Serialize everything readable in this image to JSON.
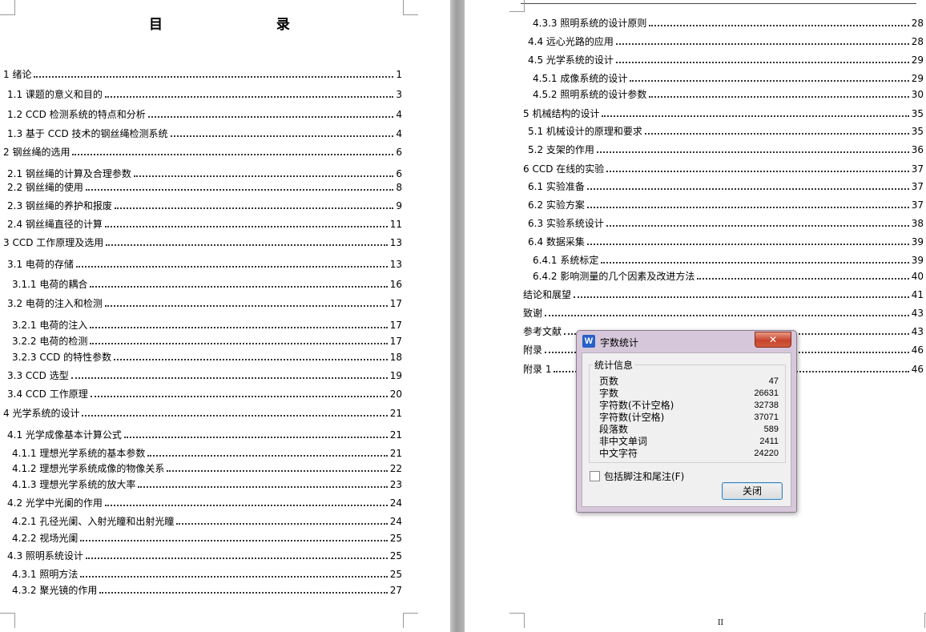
{
  "left_page": {
    "title": "目 录",
    "entries": [
      {
        "text": "1 绪论",
        "page": "1"
      },
      {
        "text": "1.1 课题的意义和目的",
        "page": "3"
      },
      {
        "text": "1.2 CCD 检测系统的特点和分析",
        "page": "4"
      },
      {
        "text": "1.3 基于 CCD 技术的钢丝绳检测系统",
        "page": "4"
      },
      {
        "text": "2 钢丝绳的选用",
        "page": "6"
      },
      {
        "text": "2.1 钢丝绳的计算及合理参数",
        "page": "6"
      },
      {
        "text": "2.2 钢丝绳的使用",
        "page": "8"
      },
      {
        "text": "2.3 钢丝绳的养护和报废",
        "page": "9"
      },
      {
        "text": "2.4 钢丝绳直径的计算",
        "page": "11"
      },
      {
        "text": "3 CCD 工作原理及选用",
        "page": "13"
      },
      {
        "text": "3.1 电荷的存储",
        "page": "13"
      },
      {
        "text": "3.1.1 电荷的耦合",
        "page": "16"
      },
      {
        "text": "3.2 电荷的注入和检测",
        "page": "17"
      },
      {
        "text": "3.2.1 电荷的注入",
        "page": "17"
      },
      {
        "text": "3.2.2 电荷的检测",
        "page": "17"
      },
      {
        "text": "3.2.3 CCD 的特性参数",
        "page": "18"
      },
      {
        "text": "3.3 CCD 选型",
        "page": "19"
      },
      {
        "text": "3.4 CCD 工作原理",
        "page": "20"
      },
      {
        "text": "4 光学系统的设计",
        "page": "21"
      },
      {
        "text": "4.1 光学成像基本计算公式",
        "page": "21"
      },
      {
        "text": "4.1.1 理想光学系统的基本参数",
        "page": "21"
      },
      {
        "text": "4.1.2 理想光学系统成像的物像关系",
        "page": "22"
      },
      {
        "text": "4.1.3 理想光学系统的放大率",
        "page": "23"
      },
      {
        "text": "4.2 光学中光阑的作用",
        "page": "24"
      },
      {
        "text": "4.2.1 孔径光阑、入射光瞳和出射光瞳",
        "page": "24"
      },
      {
        "text": "4.2.2 视场光阑",
        "page": "25"
      },
      {
        "text": "4.3 照明系统设计",
        "page": "25"
      },
      {
        "text": "4.3.1 照明方法",
        "page": "25"
      },
      {
        "text": "4.3.2 聚光镜的作用",
        "page": "27"
      }
    ]
  },
  "right_page": {
    "entries": [
      {
        "text": "4.3.3 照明系统的设计原则",
        "page": "28"
      },
      {
        "text": "4.4 远心光路的应用",
        "page": "28"
      },
      {
        "text": "4.5 光学系统的设计",
        "page": "29"
      },
      {
        "text": "4.5.1 成像系统的设计",
        "page": "29"
      },
      {
        "text": "4.5.2 照明系统的设计参数",
        "page": "30"
      },
      {
        "text": "5 机械结构的设计",
        "page": "35"
      },
      {
        "text": "5.1 机械设计的原理和要求",
        "page": "35"
      },
      {
        "text": "5.2 支架的作用",
        "page": "36"
      },
      {
        "text": "6 CCD 在线的实验",
        "page": "37"
      },
      {
        "text": "6.1 实验准备",
        "page": "37"
      },
      {
        "text": "6.2 实验方案",
        "page": "37"
      },
      {
        "text": "6.3 实验系统设计",
        "page": "38"
      },
      {
        "text": "6.4 数据采集",
        "page": "39"
      },
      {
        "text": "6.4.1 系统标定",
        "page": "39"
      },
      {
        "text": "6.4.2 影响测量的几个因素及改进方法",
        "page": "40"
      },
      {
        "text": "结论和展望",
        "page": "41"
      },
      {
        "text": "致谢",
        "page": "43"
      },
      {
        "text": "参考文献",
        "page": "43"
      },
      {
        "text": "附录",
        "page": "46"
      },
      {
        "text": "附录 1",
        "page": "46"
      }
    ],
    "footer_page_number": "II"
  },
  "dialog": {
    "app_icon_letter": "W",
    "title": "字数统计",
    "close_glyph": "✕",
    "group_label": "统计信息",
    "stats": [
      {
        "label": "页数",
        "value": "47"
      },
      {
        "label": "字数",
        "value": "26631"
      },
      {
        "label": "字符数(不计空格)",
        "value": "32738"
      },
      {
        "label": "字符数(计空格)",
        "value": "37071"
      },
      {
        "label": "段落数",
        "value": "589"
      },
      {
        "label": "非中文单词",
        "value": "2411"
      },
      {
        "label": "中文字符",
        "value": "24220"
      }
    ],
    "checkbox_label": "包括脚注和尾注(F)",
    "checkbox_checked": false,
    "close_button_label": "关闭"
  }
}
